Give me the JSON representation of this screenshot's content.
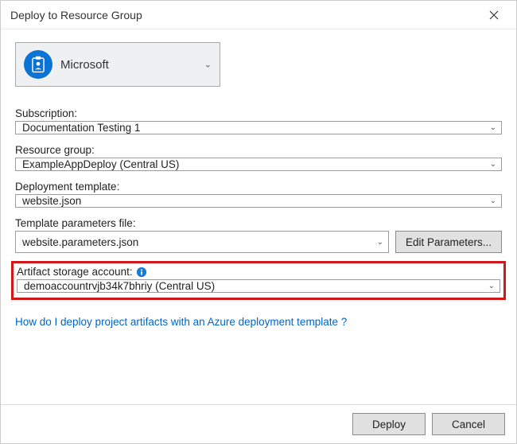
{
  "window": {
    "title": "Deploy to Resource Group"
  },
  "account": {
    "name": "Microsoft"
  },
  "fields": {
    "subscription": {
      "label": "Subscription:",
      "value": "Documentation Testing 1"
    },
    "resourceGroup": {
      "label": "Resource group:",
      "value": "ExampleAppDeploy (Central US)"
    },
    "deploymentTemplate": {
      "label": "Deployment template:",
      "value": "website.json"
    },
    "templateParams": {
      "label": "Template parameters file:",
      "value": "website.parameters.json",
      "editButton": "Edit Parameters..."
    },
    "artifactStorage": {
      "label": "Artifact storage account:",
      "value": "demoaccountrvjb34k7bhriy (Central US)"
    }
  },
  "helpLink": "How do I deploy project artifacts with an Azure deployment template ?",
  "buttons": {
    "deploy": "Deploy",
    "cancel": "Cancel"
  }
}
